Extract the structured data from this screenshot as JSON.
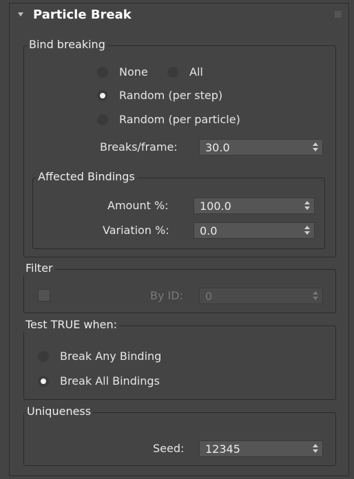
{
  "panel": {
    "title": "Particle Break"
  },
  "bind_breaking": {
    "label": "Bind breaking",
    "none_label": "None",
    "all_label": "All",
    "random_step_label": "Random (per step)",
    "random_particle_label": "Random (per particle)",
    "breaks_label": "Breaks/frame:",
    "breaks_value": "30.0",
    "selected": "Random (per step)"
  },
  "affected": {
    "label": "Affected Bindings",
    "amount_label": "Amount %:",
    "amount_value": "100.0",
    "variation_label": "Variation %:",
    "variation_value": "0.0"
  },
  "filter": {
    "label": "Filter",
    "byid_label": "By ID:",
    "byid_value": "0",
    "enabled": false
  },
  "test": {
    "label": "Test TRUE when:",
    "any_label": "Break Any Binding",
    "all_label": "Break All Bindings",
    "selected": "Break All Bindings"
  },
  "uniqueness": {
    "label": "Uniqueness",
    "seed_label": "Seed:",
    "seed_value": "12345"
  }
}
